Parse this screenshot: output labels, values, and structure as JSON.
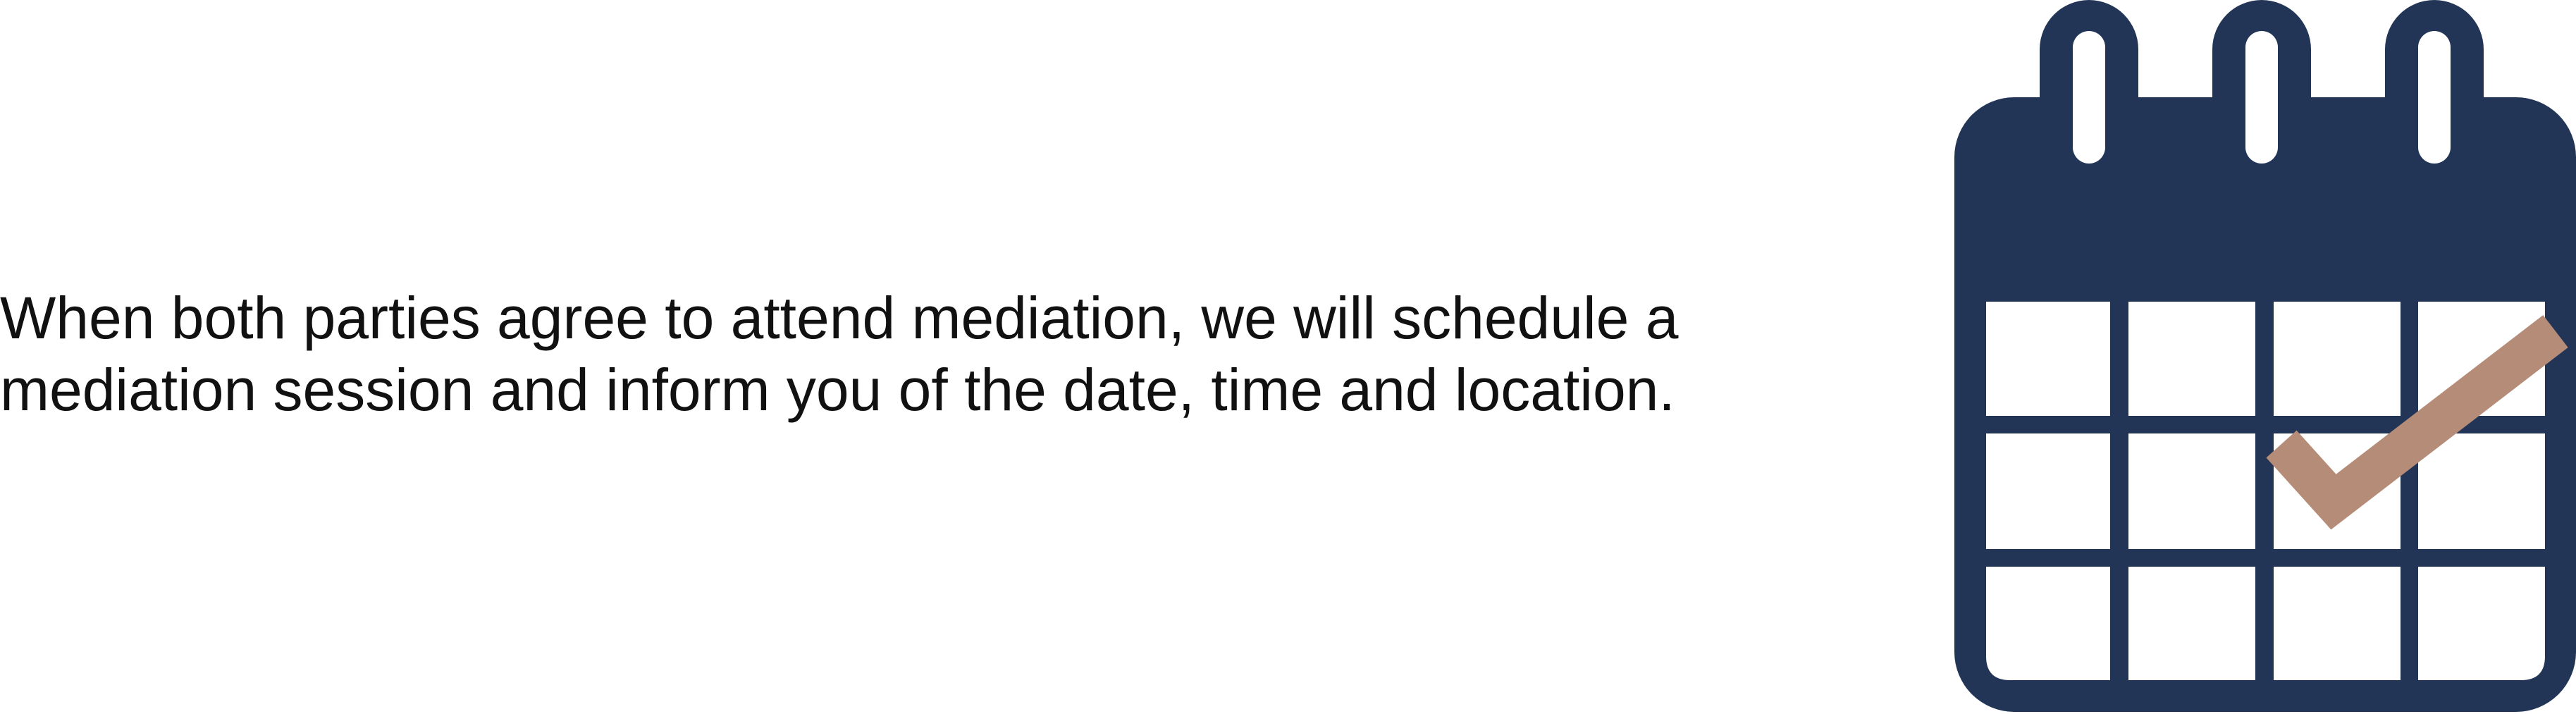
{
  "message": {
    "line1": "When both parties agree to attend mediation, we will schedule a",
    "line2": "mediation session and inform you of the date, time and location."
  },
  "icon": {
    "name": "calendar-check-icon",
    "colors": {
      "body": "#223556",
      "check": "#b58c77",
      "cells": "#ffffff"
    }
  }
}
